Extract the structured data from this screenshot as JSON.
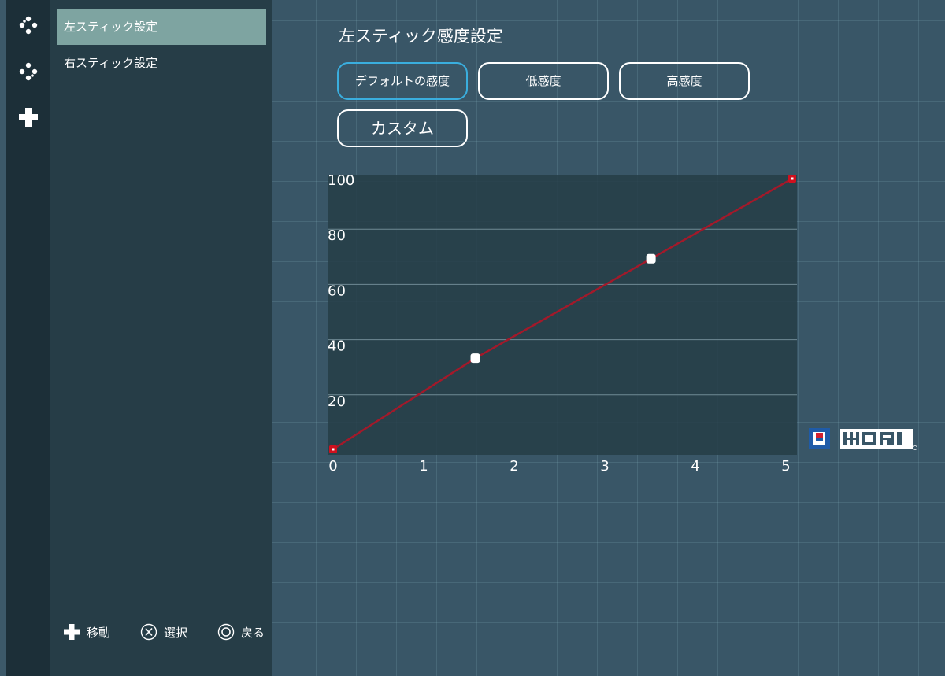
{
  "sidebar": {
    "items": [
      {
        "label": "左スティック設定",
        "selected": true
      },
      {
        "label": "右スティック設定",
        "selected": false
      }
    ]
  },
  "rail": {
    "icons": [
      "left-stick-icon",
      "right-stick-icon",
      "dpad-icon"
    ]
  },
  "footer": {
    "move": "移動",
    "select": "選択",
    "back": "戻る"
  },
  "panel": {
    "title": "左スティック感度設定",
    "presets": {
      "default": "デフォルトの感度",
      "low": "低感度",
      "high": "高感度",
      "custom": "カスタム"
    },
    "active_preset": "default"
  },
  "colors": {
    "accent": "#3aaede",
    "curve": "#a3192a",
    "selected_item": "#7ea4a1"
  },
  "chart_data": {
    "type": "line",
    "x": [
      0,
      1.57,
      3.51,
      5.07
    ],
    "y": [
      2,
      35,
      71,
      100
    ],
    "point_types": [
      "endpoint",
      "control",
      "control",
      "endpoint"
    ],
    "x_ticks": [
      "0",
      "1",
      "2",
      "3",
      "4",
      "5"
    ],
    "y_ticks": [
      "20",
      "40",
      "60",
      "80",
      "100"
    ],
    "xlim": [
      0,
      5.07
    ],
    "ylim": [
      0,
      100
    ],
    "grid": "horizontal"
  },
  "brand": {
    "name": "HORI"
  }
}
